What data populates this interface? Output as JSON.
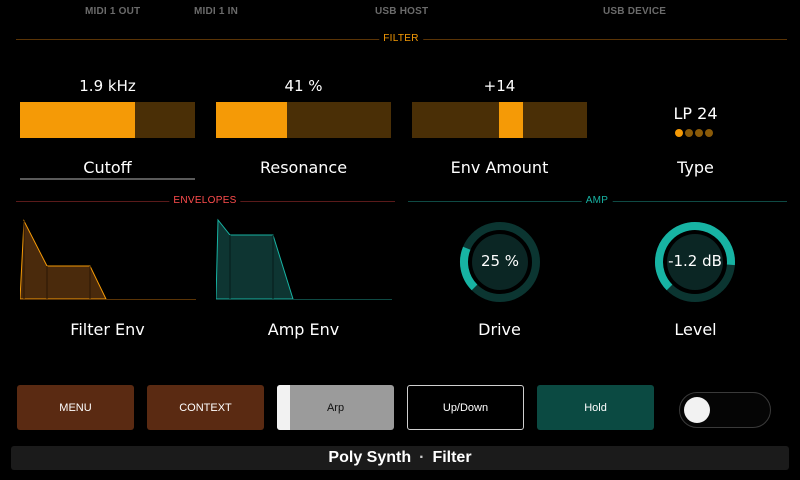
{
  "topbar": {
    "midi_out": "MIDI 1 OUT",
    "midi_in": "MIDI 1 IN",
    "usb_host": "USB HOST",
    "usb_device": "USB DEVICE"
  },
  "sections": {
    "filter": "FILTER",
    "envelopes": "ENVELOPES",
    "amp": "AMP"
  },
  "colors": {
    "filter_accent": "#f59a06",
    "envelopes_accent": "#ff4d4d",
    "amp_accent": "#17b3a3"
  },
  "filter": {
    "cutoff": {
      "value": "1.9 kHz",
      "label": "Cutoff",
      "level": 0.66
    },
    "resonance": {
      "value": "41 %",
      "label": "Resonance",
      "level": 0.41
    },
    "env_amount": {
      "value": "+14",
      "label": "Env Amount",
      "level": 0.57
    },
    "type": {
      "value": "LP 24",
      "label": "Type",
      "poles_total": 4,
      "poles_active": 1
    }
  },
  "envelopes": {
    "filter_env": {
      "label": "Filter Env"
    },
    "amp_env": {
      "label": "Amp Env"
    }
  },
  "amp": {
    "drive": {
      "value": "25 %",
      "label": "Drive",
      "level": 0.25
    },
    "level": {
      "value": "-1.2 dB",
      "label": "Level",
      "level": 0.85
    }
  },
  "buttons": {
    "menu": "MENU",
    "context": "CONTEXT",
    "arp": "Arp",
    "up_down": "Up/Down",
    "hold": "Hold"
  },
  "status": {
    "preset": "Poly Synth",
    "separator": "·",
    "page": "Filter"
  }
}
